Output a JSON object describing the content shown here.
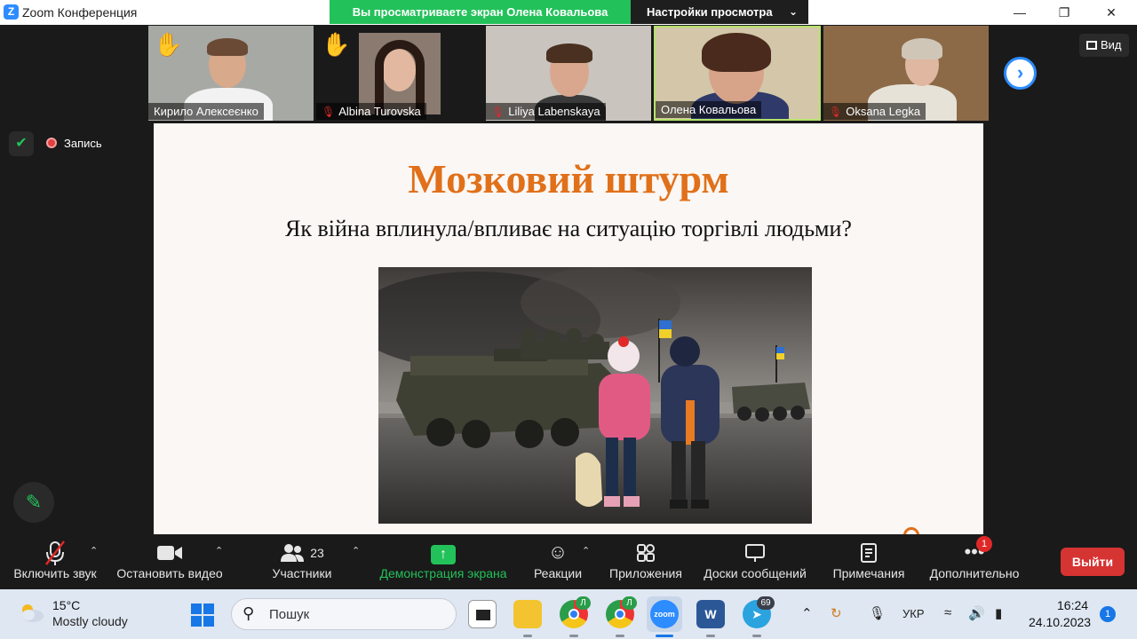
{
  "window": {
    "app_title": "Zoom Конференция",
    "share_banner": "Вы просматриваете экран Олена Ковальова",
    "view_settings": "Настройки просмотра",
    "minimize_glyph": "—",
    "maximize_glyph": "❐",
    "close_glyph": "✕"
  },
  "participants": [
    {
      "name": "Кирило Алексеєнко",
      "hand_raised": true,
      "muted": false
    },
    {
      "name": "Albina Turovska",
      "hand_raised": true,
      "muted": true
    },
    {
      "name": "Liliya Labenskaya",
      "hand_raised": false,
      "muted": true
    },
    {
      "name": "Олена Ковальова",
      "hand_raised": false,
      "muted": false,
      "active_speaker": true
    },
    {
      "name": "Oksana Legka",
      "hand_raised": false,
      "muted": true
    }
  ],
  "view_button": "Вид",
  "recording_label": "Запись",
  "slide": {
    "title": "Мозковий штурм",
    "subtitle": "Як війна вплинула/впливає на ситуацію торгівлі людьми?"
  },
  "toolbar": {
    "unmute": "Включить звук",
    "stop_video": "Остановить видео",
    "participants": "Участники",
    "participants_count": "23",
    "share_screen": "Демонстрация экрана",
    "reactions": "Реакции",
    "apps": "Приложения",
    "whiteboards": "Доски сообщений",
    "notes": "Примечания",
    "more": "Дополнительно",
    "more_badge": "1",
    "leave": "Выйти"
  },
  "taskbar": {
    "weather_temp": "15°C",
    "weather_desc": "Mostly cloudy",
    "search_placeholder": "Пошук",
    "telegram_badge": "69",
    "chrome_profile_1": "Л",
    "chrome_profile_2": "Л",
    "word_letter": "W",
    "zoom_label": "zoom",
    "language": "УКР",
    "time": "16:24",
    "date": "24.10.2023",
    "notifications": "1"
  },
  "colors": {
    "zoom_blue": "#2D8CFF",
    "share_green": "#23c15a",
    "slide_title": "#e0701a",
    "leave_red": "#d63333"
  }
}
